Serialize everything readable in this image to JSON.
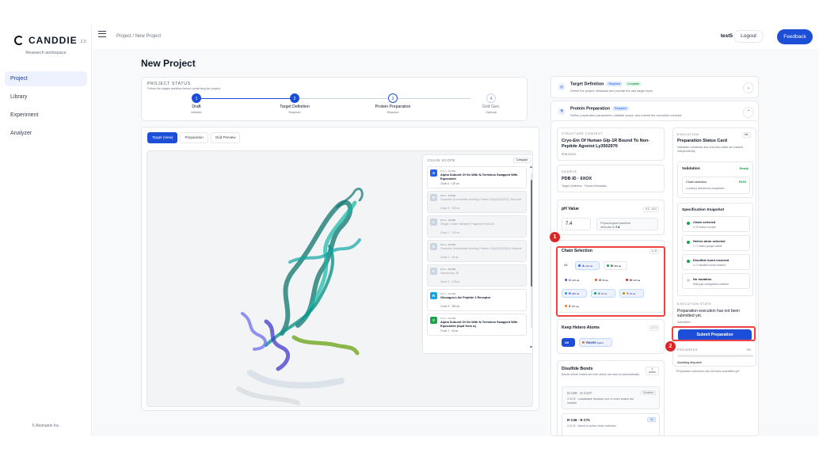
{
  "app": {
    "name": "CANDDIE",
    "version": "2.0",
    "workspace": "Research workspace",
    "copyright": "© Atomatrix Inc."
  },
  "sidebar": {
    "items": [
      {
        "label": "Project",
        "active": true
      },
      {
        "label": "Library",
        "active": false
      },
      {
        "label": "Experiment",
        "active": false
      },
      {
        "label": "Analyzer",
        "active": false
      }
    ]
  },
  "topbar": {
    "breadcrumb": "Project / New Project",
    "user": "test5",
    "logout": "Logout",
    "feedback": "Feedback"
  },
  "page": {
    "title": "New Project"
  },
  "project_status": {
    "title": "PROJECT STATUS",
    "subtitle": "Follow the stages workflow before confirming the project.",
    "steps": [
      {
        "num": "1",
        "name": "Draft",
        "sub": "Initialize",
        "state": "done"
      },
      {
        "num": "2",
        "name": "Target Definition",
        "sub": "Required",
        "state": "done"
      },
      {
        "num": "3",
        "name": "Protein Preparation",
        "sub": "Required",
        "state": "current"
      },
      {
        "num": "4",
        "name": "Grid Gen.",
        "sub": "Optional",
        "state": "disabled"
      }
    ]
  },
  "viewer": {
    "tabs": [
      {
        "label": "Target (View)",
        "active": true
      },
      {
        "label": "Preparation",
        "active": false
      },
      {
        "label": "Grid Preview",
        "active": false
      }
    ],
    "scope": {
      "title": "CHAIN SCOPE",
      "compact": "Compact",
      "full_label": "FULL NAME",
      "chains": [
        {
          "letter": "A",
          "color": "#2563eb",
          "name": "Alpha Subunit Of Gs With N-Terminus Swapped With Equivalent",
          "meta": "Chain A · 128 aa",
          "active": true
        },
        {
          "letter": "B",
          "color": "#94a3b8",
          "name": "Guanine Nucleotide-binding Protein G(I)/G(S)/G(T) Subunit",
          "meta": "Chain B · 339 aa",
          "active": false
        },
        {
          "letter": "C",
          "color": "#94a3b8",
          "name": "Single Chain Variable Fragment Scfv16",
          "meta": "Chain C · 120 aa",
          "active": false
        },
        {
          "letter": "D",
          "color": "#94a3b8",
          "name": "Guanine Nucleotide-binding Protein G(I)/G(S)/G(O) Subunit",
          "meta": "Chain D · 59 aa",
          "active": false
        },
        {
          "letter": "E",
          "color": "#94a3b8",
          "name": "Nanobody 35",
          "meta": "Chain E · 128 aa",
          "active": false
        },
        {
          "letter": "R",
          "color": "#0ea5e9",
          "name": "Glucagon-Like Peptide 1 Receptor",
          "meta": "Chain R · 389 aa",
          "active": true
        },
        {
          "letter": "X",
          "color": "#16a34a",
          "name": "Alpha Subunit Of Gs With N-Terminus Swapped With Equivalent (tspd from A)",
          "meta": "Chain X · 46 aa",
          "active": true
        }
      ]
    }
  },
  "target_definition": {
    "title": "Target Definition",
    "badge1": "Required",
    "badge2": "Complete",
    "subtitle": "Define the project metadata and provide the raw target input."
  },
  "protein_preparation": {
    "title": "Protein Preparation",
    "badge": "Required",
    "subtitle": "Define preparation parameters, validate scope, and submit the execution contract."
  },
  "structure": {
    "label": "STRUCTURE CONTEXT",
    "title": "Cryo-Em Of Human Glp-1R Bound To Non-Peptide Agonist Ly3502970",
    "pdb": "PDB 6XOX"
  },
  "source": {
    "label": "SOURCE",
    "value": "PDB ID · 6XOX",
    "sub": "Target Definition · Parsed Metadata"
  },
  "ph": {
    "title": "pH Value",
    "range": "0.0 - 14.0",
    "value": "7.4",
    "note_a": "Physiological baseline",
    "note_b": "defaults to",
    "note_value": "7.4"
  },
  "chain_selection": {
    "title": "Chain Selection",
    "count": "4 / 8",
    "all": "All",
    "chips": [
      {
        "letter": "A",
        "aa": "128 aa",
        "color": "#2563eb",
        "selected": true
      },
      {
        "letter": "B",
        "aa": "339 aa",
        "color": "#16a34a",
        "selected": false
      },
      {
        "letter": "C",
        "aa": "120 aa",
        "color": "#7c3aed",
        "selected": false
      },
      {
        "letter": "G",
        "aa": "59 aa",
        "color": "#ea580c",
        "selected": false
      },
      {
        "letter": "N",
        "aa": "128 aa",
        "color": "#dc2626",
        "selected": false
      },
      {
        "letter": "R",
        "aa": "389 aa",
        "color": "#0ea5e9",
        "selected": true
      },
      {
        "letter": "X",
        "aa": "46 aa",
        "color": "#16a34a",
        "selected": true
      },
      {
        "letter": "Y",
        "aa": "46 aa",
        "color": "#ca8a04",
        "selected": true
      },
      {
        "letter": "Z",
        "aa": "197 aa",
        "color": "#f97316",
        "selected": false
      }
    ]
  },
  "hetero": {
    "title": "Keep Hetero Atoms",
    "count": "1 / 1",
    "all": "All",
    "ligand": "RAV90",
    "ligand_tag": "ligand"
  },
  "disulfide": {
    "title": "Disulfide Bonds",
    "badge": "4 active",
    "subtitle": "Bonds where chains are both active are kept on automatically.",
    "bonds": [
      {
        "title": "N C89 · N C107",
        "sub": "2.02 Å · unavailable because one or more chains are inactive",
        "tag": "Disabled"
      },
      {
        "title": "R C46 · R C71",
        "sub": "2.02 Å · linked to active chain selection",
        "tag": "On"
      }
    ]
  },
  "execution": {
    "label": "EXECUTION",
    "tag": "Idle",
    "title": "Preparation Status Card",
    "sub": "Validation readiness and execution state are tracked independently.",
    "validation": {
      "title": "Validation",
      "state": "Ready",
      "chain_label": "Chain selection",
      "chain_status": "PASS",
      "chain_sub": "4 chain(s) selected for preparation."
    },
    "snapshot": {
      "title": "Specification Snapshot",
      "items": [
        {
          "title": "Chain selected",
          "sub": "4 / 8 chains in scope",
          "color": "#16a34a"
        },
        {
          "title": "Hetero atom selected",
          "sub": "1 / 1 hetero groups visible",
          "color": "#16a34a"
        },
        {
          "title": "Disulfide bond resolved",
          "sub": "4 / 4 disulfide bonds retained",
          "color": "#16a34a"
        },
        {
          "title": "No mutation",
          "sub": "Wild-type configuration retained",
          "color": "#d1d5db"
        }
      ]
    },
    "state_label": "EXECUTION STATE",
    "state_text": "Preparation execution has not been submitted yet.",
    "state_sub": "Submitted: -",
    "submit": "Submit Preparation",
    "progress_label": "PROGRESS",
    "progress_value": "0%",
    "progress": 0,
    "awaiting": "Awaiting dispatch",
    "awaiting_sub": "Preparation execution has not been submitted yet."
  },
  "markers": [
    "1",
    "2"
  ]
}
